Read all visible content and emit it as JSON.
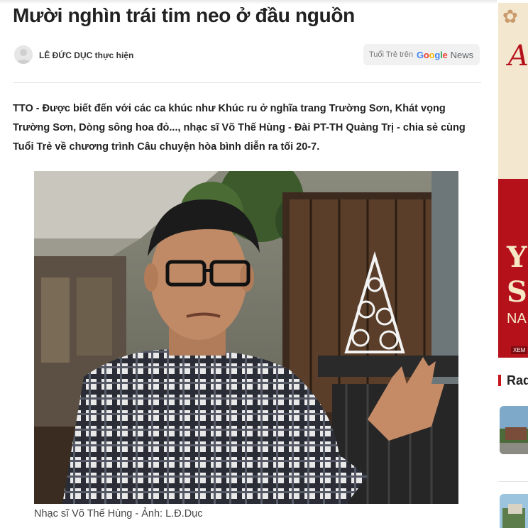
{
  "article": {
    "title": "Mười nghìn trái tim neo ở đầu nguồn",
    "author": "LÊ ĐỨC DỤC thực hiện",
    "google_news": {
      "prefix": "Tuổi Trẻ trên",
      "logo_letters": [
        "G",
        "o",
        "o",
        "g",
        "l",
        "e"
      ],
      "suffix": "News"
    },
    "lead": "TTO - Được biết đến với các ca khúc như Khúc ru ở nghĩa trang Trường Sơn, Khát vọng Trường Sơn, Dòng sông hoa đỏ..., nhạc sĩ Võ Thế Hùng - Đài PT-TH Quảng Trị - chia sẻ cùng Tuổi Trẻ về chương trình Câu chuyện hòa bình diễn ra tối 20-7.",
    "photo_caption": "Nhạc sĩ Võ Thế Hùng - Ảnh: L.Đ.Dục"
  },
  "sidebar": {
    "ad": {
      "letter_top": "A",
      "letter_y": "Y",
      "letter_s": "S",
      "text_na": "NA",
      "button_xem": "XEM"
    },
    "section_title": "Rad"
  },
  "colors": {
    "accent_red": "#c4161c",
    "ad_red": "#b5111b",
    "text": "#222222"
  },
  "icons": {
    "avatar": "user-avatar-icon",
    "flower": "flower-ornament-icon"
  }
}
